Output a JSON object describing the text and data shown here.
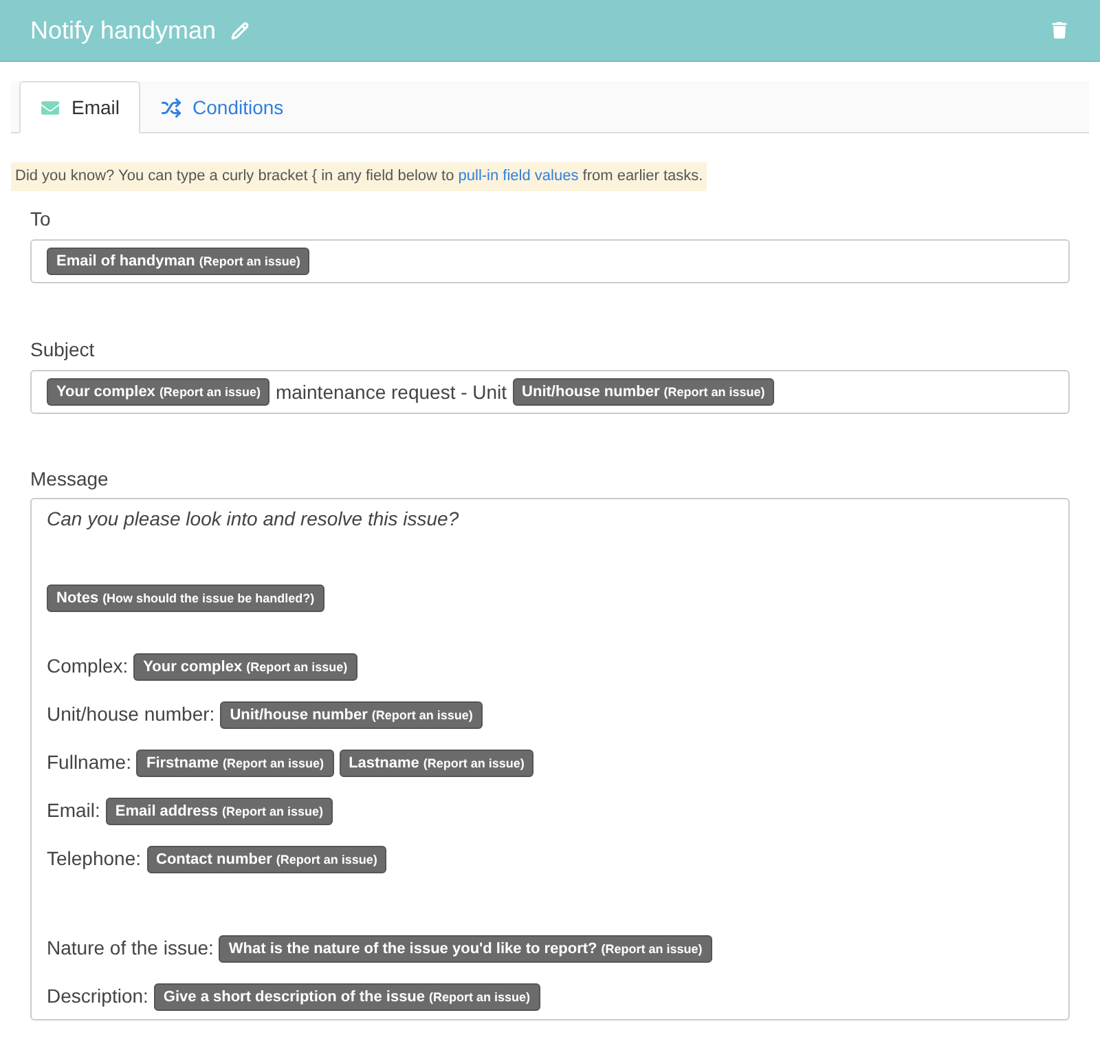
{
  "header": {
    "title": "Notify handyman"
  },
  "tabs": [
    {
      "label": "Email",
      "selected": true,
      "kind": "email"
    },
    {
      "label": "Conditions",
      "selected": false,
      "kind": "conditions"
    }
  ],
  "tip": {
    "before": "Did you know? You can type a curly bracket { in any field below to",
    "link": "pull-in field values",
    "after": "from earlier tasks."
  },
  "fields": [
    {
      "label": "To",
      "parts": [
        {
          "kind": "token",
          "name": "Email of handyman",
          "note": "(Report an issue)"
        }
      ]
    },
    {
      "label": "Subject",
      "parts": [
        {
          "kind": "token",
          "name": "Your complex",
          "note": "(Report an issue)"
        },
        {
          "kind": "text",
          "text": "maintenance request - Unit"
        },
        {
          "kind": "token",
          "name": "Unit/house number",
          "note": "(Report an issue)"
        }
      ]
    }
  ],
  "message": {
    "label": "Message",
    "lines": [
      {
        "kind": "italic",
        "parts": [
          {
            "kind": "text",
            "text": "Can you please look into and resolve this issue?"
          }
        ]
      },
      {
        "kind": "blank"
      },
      {
        "kind": "blank"
      },
      {
        "kind": "line",
        "parts": [
          {
            "kind": "token",
            "name": "Notes",
            "note": "(How should the issue be handled?)"
          }
        ]
      },
      {
        "kind": "blank"
      },
      {
        "kind": "line",
        "parts": [
          {
            "kind": "text",
            "text": "Complex:"
          },
          {
            "kind": "token",
            "name": "Your complex",
            "note": "(Report an issue)"
          }
        ]
      },
      {
        "kind": "line",
        "parts": [
          {
            "kind": "text",
            "text": "Unit/house number:"
          },
          {
            "kind": "token",
            "name": "Unit/house number",
            "note": "(Report an issue)"
          }
        ]
      },
      {
        "kind": "line",
        "parts": [
          {
            "kind": "text",
            "text": "Fullname:"
          },
          {
            "kind": "token",
            "name": "Firstname",
            "note": "(Report an issue)"
          },
          {
            "kind": "token",
            "name": "Lastname",
            "note": "(Report an issue)"
          }
        ]
      },
      {
        "kind": "line",
        "parts": [
          {
            "kind": "text",
            "text": "Email:"
          },
          {
            "kind": "token",
            "name": "Email address",
            "note": "(Report an issue)"
          }
        ]
      },
      {
        "kind": "line",
        "parts": [
          {
            "kind": "text",
            "text": "Telephone:"
          },
          {
            "kind": "token",
            "name": "Contact number",
            "note": "(Report an issue)"
          }
        ]
      },
      {
        "kind": "blank"
      },
      {
        "kind": "blank"
      },
      {
        "kind": "line",
        "parts": [
          {
            "kind": "text",
            "text": "Nature of the issue:"
          },
          {
            "kind": "token",
            "name": "What is the nature of the issue you'd like to report?",
            "note": "(Report an issue)"
          }
        ]
      },
      {
        "kind": "line",
        "parts": [
          {
            "kind": "text",
            "text": "Description:"
          },
          {
            "kind": "token",
            "name": "Give a short description of the issue",
            "note": "(Report an issue)"
          }
        ]
      }
    ]
  }
}
